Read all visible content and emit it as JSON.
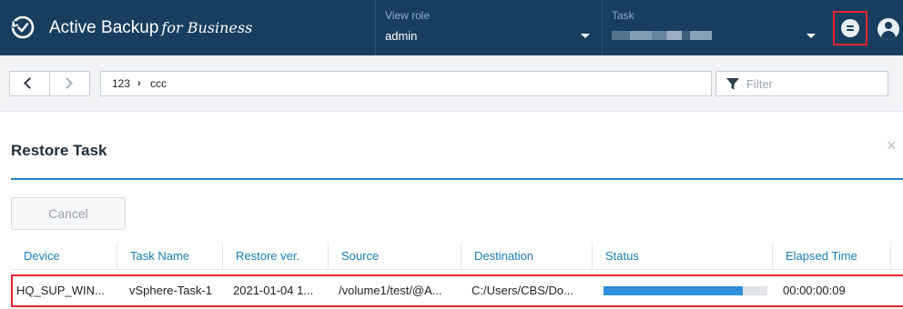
{
  "app": {
    "title": "Active Backup",
    "title_suffix": "for Business",
    "colors": {
      "header_bg": "#173e5e",
      "accent": "#1e88bf",
      "highlight_box": "#e3262f"
    }
  },
  "header": {
    "view_role": {
      "label": "View role",
      "value": "admin"
    },
    "task": {
      "label": "Task",
      "value_blurred": true
    },
    "messages_icon": "message-icon",
    "user_icon": "user-icon"
  },
  "toolbar": {
    "back_icon": "chevron-left-icon",
    "forward_icon": "chevron-right-icon",
    "breadcrumb": [
      "123",
      "ccc"
    ],
    "breadcrumb_separator": "›",
    "filter_placeholder": "Filter"
  },
  "dialog": {
    "title": "Restore Task",
    "close_glyph": "×",
    "cancel_label": "Cancel",
    "columns": [
      "Device",
      "Task Name",
      "Restore ver.",
      "Source",
      "Destination",
      "Status",
      "Elapsed Time"
    ],
    "rows": [
      {
        "device": "HQ_SUP_WIN...",
        "task_name": "vSphere-Task-1",
        "restore_ver": "2021-01-04 1...",
        "source": "/volume1/test/@A...",
        "destination": "C:/Users/CBS/Do...",
        "status_progress_percent": 85,
        "elapsed_time": "00:00:00:09"
      }
    ]
  }
}
